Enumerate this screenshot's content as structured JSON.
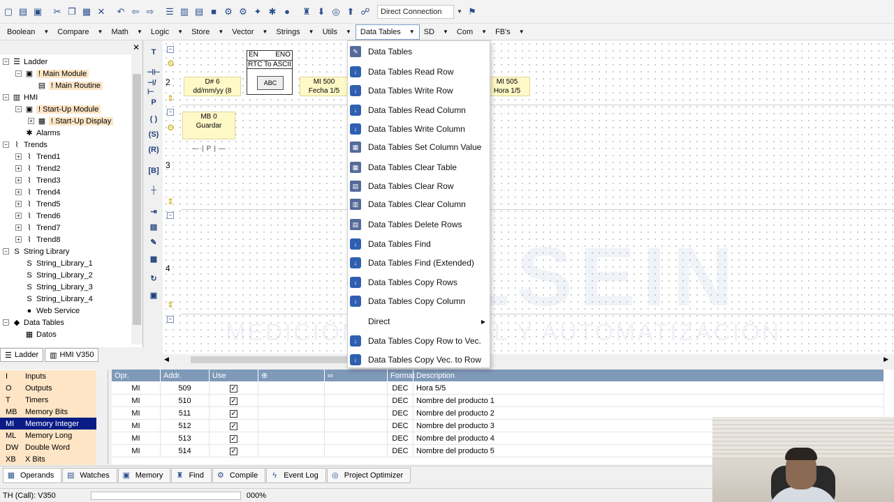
{
  "toolbar": {
    "connection": "Direct Connection"
  },
  "menubar": {
    "items": [
      "Boolean",
      "Compare",
      "Math",
      "Logic",
      "Store",
      "Vector",
      "Strings",
      "Utils",
      "Data Tables",
      "SD",
      "Com",
      "FB's"
    ]
  },
  "tree": {
    "nodes": [
      {
        "label": "Ladder",
        "icon": "ladder-icon"
      },
      {
        "label": "! Main Module",
        "icon": "module-icon"
      },
      {
        "label": "! Main Routine",
        "icon": "routine-icon"
      },
      {
        "label": "HMI",
        "icon": "hmi-icon"
      },
      {
        "label": "! Start-Up Module",
        "icon": "module-icon"
      },
      {
        "label": "! Start-Up Display",
        "icon": "display-icon"
      },
      {
        "label": "Alarms",
        "icon": "alarm-icon"
      },
      {
        "label": "Trends",
        "icon": "trend-icon"
      },
      {
        "label": "Trend1",
        "icon": "trend-icon"
      },
      {
        "label": "Trend2",
        "icon": "trend-icon"
      },
      {
        "label": "Trend3",
        "icon": "trend-icon"
      },
      {
        "label": "Trend4",
        "icon": "trend-icon"
      },
      {
        "label": "Trend5",
        "icon": "trend-icon"
      },
      {
        "label": "Trend6",
        "icon": "trend-icon"
      },
      {
        "label": "Trend7",
        "icon": "trend-icon"
      },
      {
        "label": "Trend8",
        "icon": "trend-icon"
      },
      {
        "label": "String Library",
        "icon": "string-library-icon"
      },
      {
        "label": "String_Library_1",
        "icon": "string-icon"
      },
      {
        "label": "String_Library_2",
        "icon": "string-icon"
      },
      {
        "label": "String_Library_3",
        "icon": "string-icon"
      },
      {
        "label": "String_Library_4",
        "icon": "string-icon"
      },
      {
        "label": "Web Service",
        "icon": "web-service-icon"
      },
      {
        "label": "Data Tables",
        "icon": "data-tables-icon"
      },
      {
        "label": "Datos",
        "icon": "table-icon"
      }
    ],
    "tabs": [
      "Ladder",
      "HMI V350"
    ]
  },
  "ladder": {
    "rungs": [
      "2",
      "3",
      "4"
    ],
    "block_en": "EN",
    "block_eno": "ENO",
    "block_title": "RTC To ASCII",
    "block_inner": "ABC",
    "input_operand": "D# 6",
    "input_format": "dd/mm/yy (8",
    "output1_operand": "MI 500",
    "output1_desc": "Fecha 1/5",
    "output2_operand": "MI 505",
    "output2_desc": "Hora 1/5",
    "contact_operand": "MB 0",
    "contact_desc": "Guardar",
    "contact_symbol": "P",
    "watermark_logo": "OLSEIN",
    "watermark_text": "MEDICIÓN, CONTROL Y AUTOMATIZACIÓN"
  },
  "data_tables_menu": {
    "items": [
      {
        "label": "Data Tables",
        "icon": "data-tables-icon"
      },
      {
        "label": "Data Tables Read Row",
        "icon": "read-row-icon"
      },
      {
        "label": "Data Tables Write Row",
        "icon": "write-row-icon"
      },
      {
        "label": "Data Tables Read Column",
        "icon": "read-column-icon"
      },
      {
        "label": "Data Tables Write Column",
        "icon": "write-column-icon"
      },
      {
        "label": "Data Tables Set Column Value",
        "icon": "set-column-icon"
      },
      {
        "label": "Data Tables Clear Table",
        "icon": "clear-table-icon"
      },
      {
        "label": "Data Tables Clear Row",
        "icon": "clear-row-icon"
      },
      {
        "label": "Data Tables Clear Column",
        "icon": "clear-column-icon"
      },
      {
        "label": "Data Tables Delete Rows",
        "icon": "delete-rows-icon"
      },
      {
        "label": "Data Tables Find",
        "icon": "find-icon"
      },
      {
        "label": "Data Tables Find (Extended)",
        "icon": "find-extended-icon"
      },
      {
        "label": "Data Tables Copy Rows",
        "icon": "copy-rows-icon"
      },
      {
        "label": "Data Tables Copy Column",
        "icon": "copy-column-icon"
      },
      {
        "label": "Direct",
        "icon": ""
      },
      {
        "label": "Data Tables Copy Row to Vec.",
        "icon": "copy-row-vec-icon"
      },
      {
        "label": "Data Tables Copy Vec. to Row",
        "icon": "copy-vec-row-icon"
      }
    ]
  },
  "operands": {
    "items": [
      {
        "code": "I",
        "name": "Inputs"
      },
      {
        "code": "O",
        "name": "Outputs"
      },
      {
        "code": "T",
        "name": "Timers"
      },
      {
        "code": "MB",
        "name": "Memory Bits"
      },
      {
        "code": "MI",
        "name": "Memory Integer"
      },
      {
        "code": "ML",
        "name": "Memory Long"
      },
      {
        "code": "DW",
        "name": "Double Word"
      },
      {
        "code": "XB",
        "name": "X Bits"
      }
    ],
    "selected_index": 4
  },
  "grid": {
    "columns": [
      "Opr.",
      "Addr.",
      "Use",
      "",
      "",
      "Format",
      "Description"
    ],
    "rows": [
      {
        "opr": "MI",
        "addr": "509",
        "format": "DEC",
        "description": "Hora 5/5"
      },
      {
        "opr": "MI",
        "addr": "510",
        "format": "DEC",
        "description": "Nombre del producto 1"
      },
      {
        "opr": "MI",
        "addr": "511",
        "format": "DEC",
        "description": "Nombre del producto 2"
      },
      {
        "opr": "MI",
        "addr": "512",
        "format": "DEC",
        "description": "Nombre del producto 3"
      },
      {
        "opr": "MI",
        "addr": "513",
        "format": "DEC",
        "description": "Nombre del producto 4"
      },
      {
        "opr": "MI",
        "addr": "514",
        "format": "DEC",
        "description": "Nombre del producto 5"
      }
    ]
  },
  "bottom_tabs": [
    "Operands",
    "Watches",
    "Memory",
    "Find",
    "Compile",
    "Event Log",
    "Project Optimizer"
  ],
  "status": {
    "left": "TH (Call): V350",
    "percent": "000%"
  },
  "colors": {
    "selected_operand": "#0a1b86",
    "grid_header": "#7f99b8",
    "highlight": "#fde5c6",
    "ladder_box": "#fff9c8"
  }
}
